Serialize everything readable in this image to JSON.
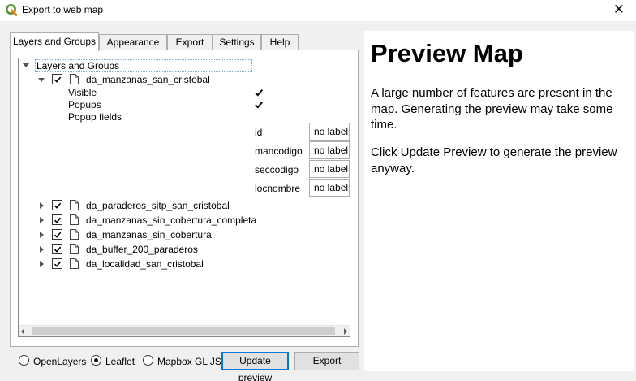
{
  "window": {
    "title": "Export to web map",
    "close_glyph": "✕"
  },
  "tabs": [
    {
      "label": "Layers and Groups",
      "active": true
    },
    {
      "label": "Appearance"
    },
    {
      "label": "Export"
    },
    {
      "label": "Settings"
    },
    {
      "label": "Help"
    }
  ],
  "tree": {
    "header": "Layers and Groups",
    "expanded_layer": {
      "name": "da_manzanas_san_cristobal",
      "checked": true,
      "properties": [
        {
          "label": "Visible",
          "checked": true
        },
        {
          "label": "Popups",
          "checked": true
        },
        {
          "label": "Popup fields"
        }
      ],
      "popup_fields": [
        {
          "field": "id",
          "value": "no label"
        },
        {
          "field": "mancodigo",
          "value": "no label"
        },
        {
          "field": "seccodigo",
          "value": "no label"
        },
        {
          "field": "locnombre",
          "value": "no label"
        }
      ]
    },
    "collapsed_layers": [
      {
        "name": "da_paraderos_sitp_san_cristobal",
        "checked": true
      },
      {
        "name": "da_manzanas_sin_cobertura_completa",
        "checked": true
      },
      {
        "name": "da_manzanas_sin_cobertura",
        "checked": true
      },
      {
        "name": "da_buffer_200_paraderos",
        "checked": true
      },
      {
        "name": "da_localidad_san_cristobal",
        "checked": true
      }
    ]
  },
  "map_format": {
    "options": [
      "OpenLayers",
      "Leaflet",
      "Mapbox GL JS"
    ],
    "selected": "Leaflet"
  },
  "buttons": {
    "update_preview": "Update preview",
    "export": "Export"
  },
  "preview": {
    "title": "Preview Map",
    "paragraphs": [
      "A large number of features are present in the map. Generating the preview may take some time.",
      "Click Update Preview to generate the preview anyway."
    ]
  },
  "colors": {
    "app_icon": "#589632",
    "focus": "#0078d7"
  }
}
